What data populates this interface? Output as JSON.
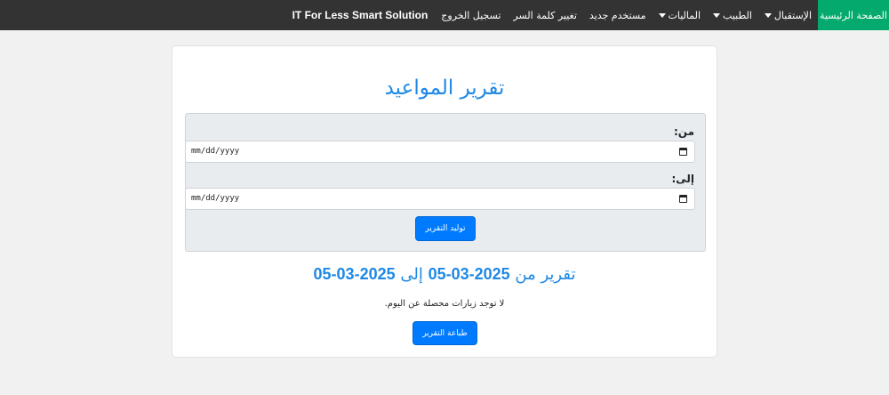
{
  "navbar": {
    "items": [
      {
        "label": "الصفحة الرئيسية",
        "active": true,
        "dropdown": false
      },
      {
        "label": "الإستقبال",
        "active": false,
        "dropdown": true
      },
      {
        "label": "الطبيب",
        "active": false,
        "dropdown": true
      },
      {
        "label": "الماليات",
        "active": false,
        "dropdown": true
      },
      {
        "label": "مستخدم جديد",
        "active": false,
        "dropdown": false
      },
      {
        "label": "تغيير كلمة السر",
        "active": false,
        "dropdown": false
      },
      {
        "label": "تسجيل الخروج",
        "active": false,
        "dropdown": false
      }
    ],
    "brand": "IT For Less Smart Solution"
  },
  "page": {
    "title": "تقرير المواعيد"
  },
  "form": {
    "from_label": "من:",
    "to_label": "إلى:",
    "date_placeholder": "mm/dd/yyyy",
    "generate_button": "توليد التقرير"
  },
  "report": {
    "prefix": "تقرير من",
    "from_date": "2025-03-05",
    "connector": "إلى",
    "to_date": "2025-03-05",
    "empty_message": "لا توجد زيارات محصلة عن اليوم.",
    "print_button": "طباعة التقرير"
  },
  "colors": {
    "navbar_bg": "#333333",
    "active_nav": "#04aa6d",
    "primary": "#007bff",
    "title_blue": "#1e88e5"
  }
}
